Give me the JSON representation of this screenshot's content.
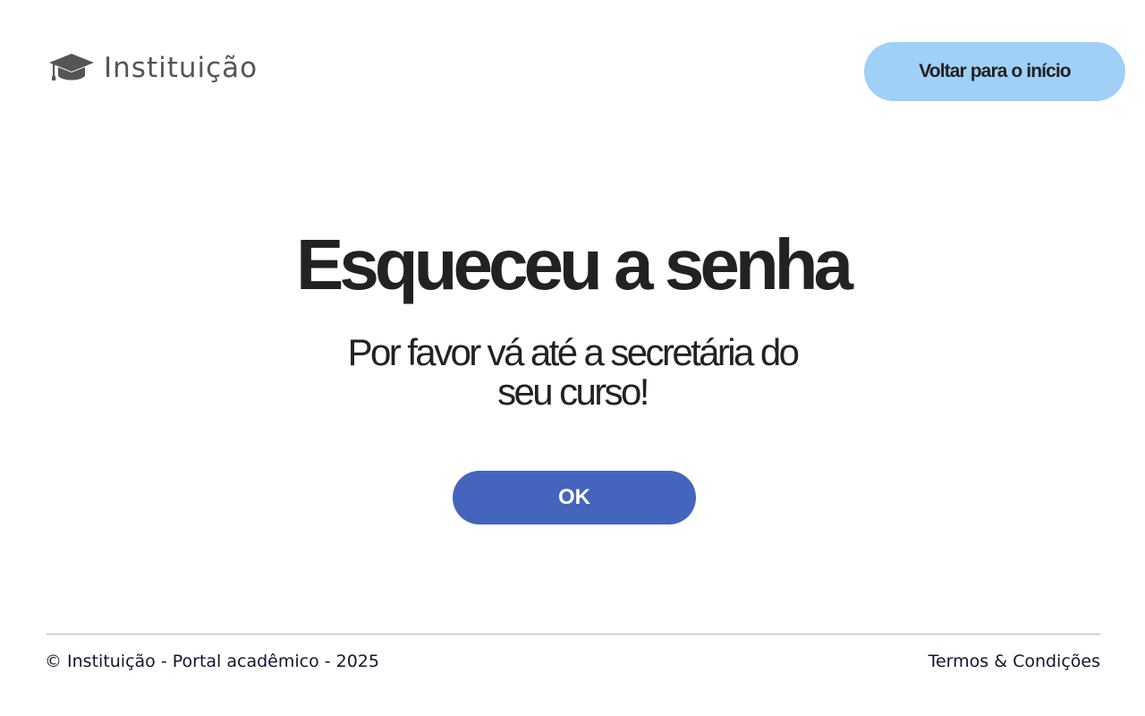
{
  "header": {
    "brand_name": "Instituição",
    "brand_icon": "graduation-cap-icon",
    "back_button_label": "Voltar para o início"
  },
  "main": {
    "title": "Esqueceu a senha",
    "message": "Por favor vá até a secretária do seu curso!",
    "ok_button_label": "OK"
  },
  "footer": {
    "copyright": "© Instituição - Portal acadêmico - 2025",
    "terms_label": "Termos & Condições"
  },
  "colors": {
    "back_button_bg": "#a0d0f5",
    "ok_button_bg": "#4564be",
    "text": "#222222",
    "icon": "#555555"
  }
}
